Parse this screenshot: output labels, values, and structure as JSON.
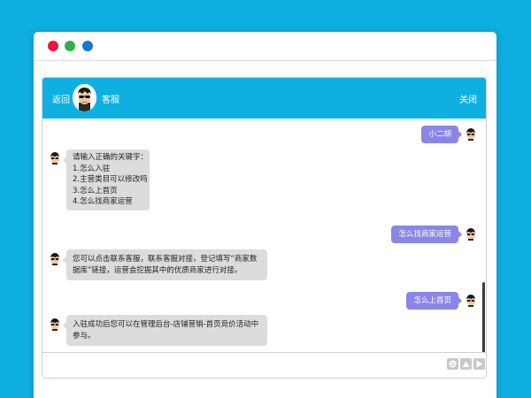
{
  "window": {
    "traffic_lights": [
      "red",
      "green",
      "blue"
    ],
    "colors": {
      "red": "#e8173f",
      "green": "#2eb34a",
      "blue": "#1577cc"
    }
  },
  "chat": {
    "header": {
      "back_label": "返回",
      "title": "客服",
      "close_label": "关闭",
      "bg": "#0eb0e2"
    },
    "messages": [
      {
        "from": "me",
        "text": "小二胡"
      },
      {
        "from": "service",
        "lines": [
          "请输入正确的关键字：",
          "1.怎么入驻",
          "2.主营类目可以修改吗",
          "3.怎么上首页",
          "4.怎么找商家运营"
        ]
      },
      {
        "from": "me",
        "text": "怎么找商家运营"
      },
      {
        "from": "service",
        "text": "您可以点击联系客服，联系客服对接，登记填写“商家数据库”链接，运营会挖掘其中的优质商家进行对接。"
      },
      {
        "from": "me",
        "text": "怎么上首页"
      },
      {
        "from": "service",
        "text": "入驻成功后您可以在管理后台-店铺营销-首页竞价活动中参与。"
      }
    ],
    "input": {
      "value": "",
      "placeholder": ""
    },
    "toolbar": [
      "emoji-icon",
      "image-upload-icon",
      "send-icon"
    ]
  }
}
